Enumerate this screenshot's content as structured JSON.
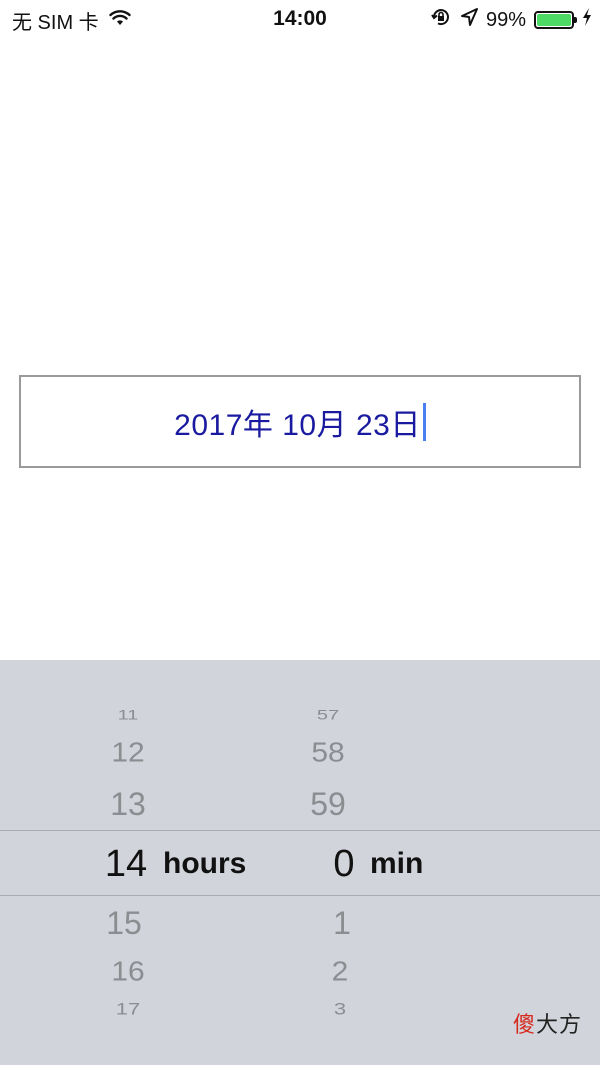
{
  "status_bar": {
    "carrier": "无 SIM 卡",
    "time": "14:00",
    "battery_percent": "99%",
    "battery_level": 0.99,
    "battery_color": "#4cd964"
  },
  "date_field": {
    "value": "2017年 10月 23日",
    "text_color": "#1a1aa0"
  },
  "picker": {
    "hours_column": [
      "11",
      "12",
      "13",
      "14",
      "15",
      "16",
      "17"
    ],
    "minutes_column": [
      "57",
      "58",
      "59",
      "0",
      "1",
      "2",
      "3"
    ],
    "selected_hour": "14",
    "selected_minute": "0",
    "hours_unit": "hours",
    "minutes_unit": "min",
    "background_color": "#d1d4da"
  },
  "watermark": {
    "char1": "傻",
    "rest": "大方"
  }
}
